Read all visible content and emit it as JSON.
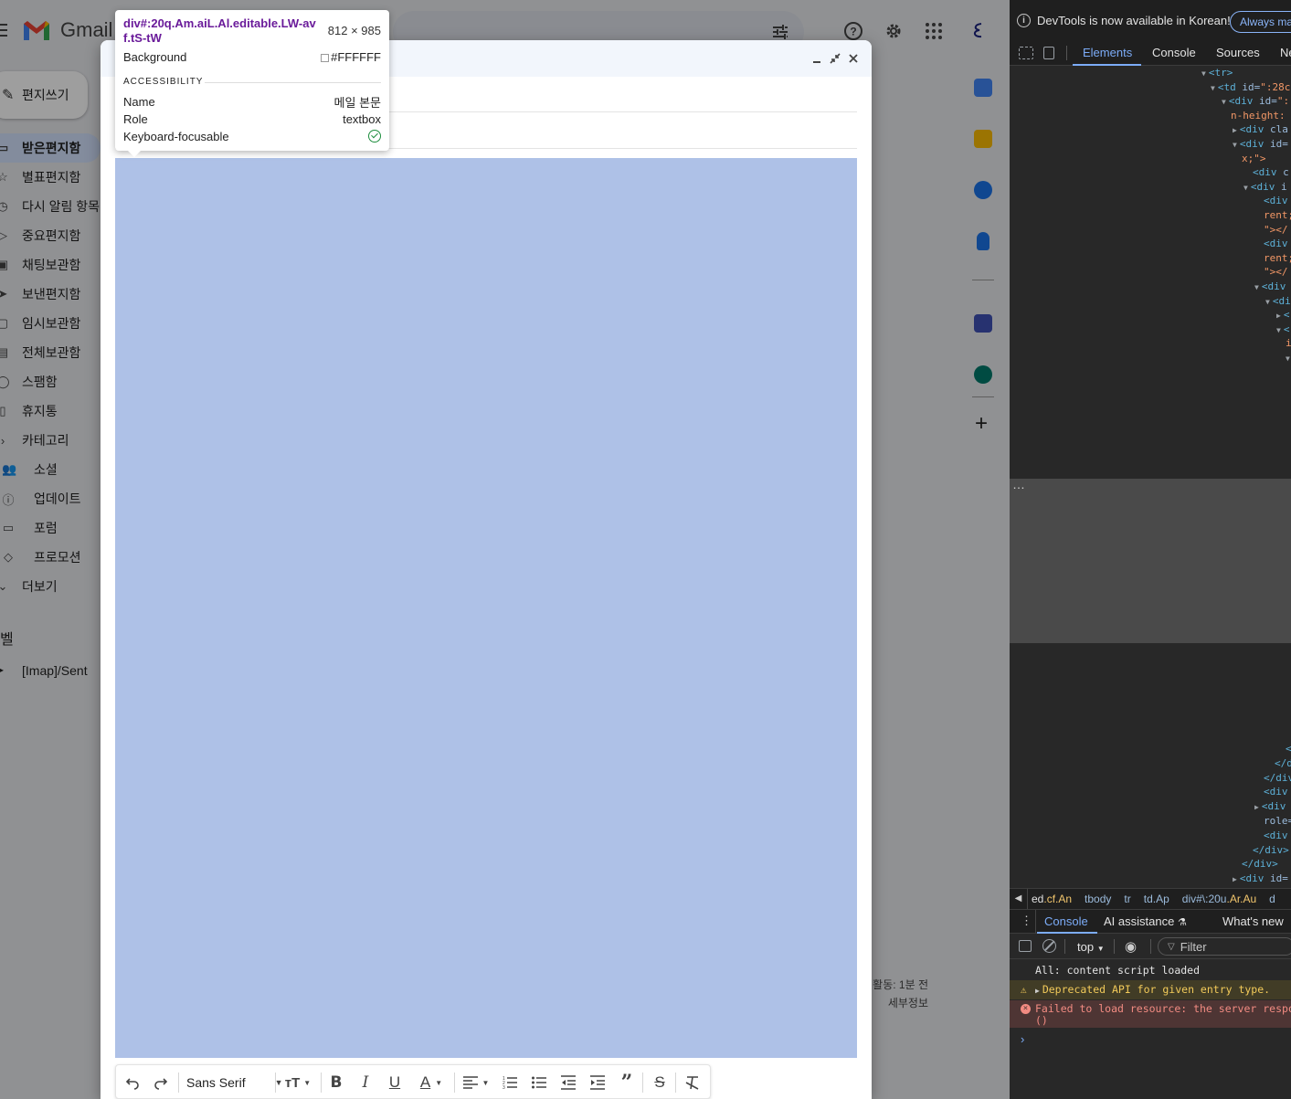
{
  "gmail": {
    "app_name": "Gmail",
    "compose_label": "편지쓰기",
    "nav_items": [
      {
        "label": "받은편지함",
        "active": true
      },
      {
        "label": "별표편지함"
      },
      {
        "label": "다시 알림 항목"
      },
      {
        "label": "중요편지함"
      },
      {
        "label": "채팅보관함"
      },
      {
        "label": "보낸편지함"
      },
      {
        "label": "임시보관함"
      },
      {
        "label": "전체보관함"
      },
      {
        "label": "스팸함"
      },
      {
        "label": "휴지통"
      },
      {
        "label": "카테고리"
      },
      {
        "label": "소셜"
      },
      {
        "label": "업데이트"
      },
      {
        "label": "포럼"
      },
      {
        "label": "프로모션"
      },
      {
        "label": "더보기"
      }
    ],
    "labels_heading": "벨",
    "label_item": "[Imap]/Sent",
    "activity_text": "활동: 1분 전",
    "details_text": "세부정보",
    "side_app_icons": [
      "calendar-icon",
      "keep-icon",
      "tasks-icon",
      "contacts-icon",
      "meet-icon",
      "webex-icon",
      "add-icon"
    ]
  },
  "compose": {
    "toolbar": {
      "font_name": "Sans Serif",
      "buttons": [
        "undo-icon",
        "redo-icon",
        "font-size-icon",
        "bold-icon",
        "italic-icon",
        "underline-icon",
        "text-color-icon",
        "align-icon",
        "numbered-list-icon",
        "bulleted-list-icon",
        "indent-less-icon",
        "indent-more-icon",
        "quote-icon",
        "strikethrough-icon",
        "remove-formatting-icon"
      ]
    },
    "body_highlight_color": "#aec1e7"
  },
  "inspector": {
    "selector": "div#:20q.Am.aiL.Al.editable.LW-avf.tS-tW",
    "size": "812 × 985",
    "background_label": "Background",
    "background_value": "#FFFFFF",
    "accessibility_heading": "ACCESSIBILITY",
    "name_label": "Name",
    "name_value": "메일 본문",
    "role_label": "Role",
    "role_value": "textbox",
    "focus_label": "Keyboard-focusable"
  },
  "devtools": {
    "banner": "DevTools is now available in Korean!",
    "banner_button": "Always ma",
    "tabs": [
      "Elements",
      "Console",
      "Sources",
      "Ne"
    ],
    "active_tab": "Elements",
    "breadcrumbs": [
      {
        "pre": "",
        "main": "ed",
        "cls": ".cf.An"
      },
      {
        "pre": "",
        "main": "tbody",
        "cls": ""
      },
      {
        "pre": "",
        "main": "tr",
        "cls": ""
      },
      {
        "pre": "",
        "main": "td",
        "cls": ".Ap"
      },
      {
        "pre": "",
        "main": "div#\\:20u",
        "cls": ".Ar.Au"
      },
      {
        "pre": "",
        "main": "d",
        "cls": ""
      }
    ],
    "drawer_tabs": [
      "Console",
      "AI assistance",
      "What's new"
    ],
    "context": "top",
    "filter_placeholder": "Filter",
    "console_messages": [
      {
        "type": "log",
        "text": "All: content script loaded"
      },
      {
        "type": "warning",
        "text": "Deprecated API for given entry type."
      },
      {
        "type": "error",
        "text": "Failed to load resource: the server respond",
        "text2": "()"
      }
    ],
    "ellipsis": "…"
  }
}
